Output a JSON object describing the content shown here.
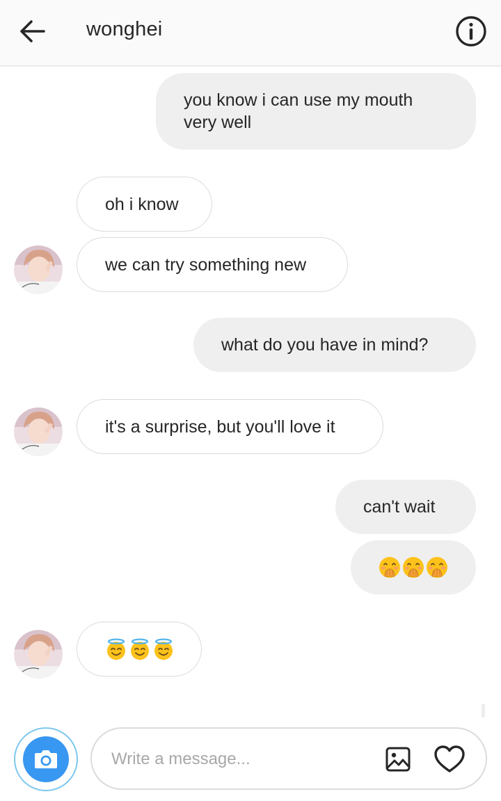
{
  "header": {
    "title": "wonghei",
    "back_icon": "arrow-left-icon",
    "info_icon": "info-circle-icon"
  },
  "messages": [
    {
      "direction": "sent",
      "lines": [
        "you know i can use my mouth",
        "very well"
      ]
    },
    {
      "direction": "received",
      "text": "oh i know"
    },
    {
      "direction": "received",
      "text": "we can try something new"
    },
    {
      "direction": "sent",
      "text": "what do you have in mind?"
    },
    {
      "direction": "received",
      "text": "it's a surprise, but you'll love it"
    },
    {
      "direction": "sent",
      "text": "can't wait"
    },
    {
      "direction": "sent",
      "emoji": [
        "hand-over-mouth-emoji",
        "hand-over-mouth-emoji",
        "hand-over-mouth-emoji"
      ]
    },
    {
      "direction": "received",
      "emoji": [
        "halo-smile-emoji",
        "halo-smile-emoji",
        "halo-smile-emoji"
      ]
    }
  ],
  "composer": {
    "placeholder": "Write a message...",
    "camera_icon": "camera-icon",
    "gallery_icon": "image-gallery-icon",
    "like_icon": "heart-icon"
  },
  "colors": {
    "sent_bubble": "#efefef",
    "received_border": "#dbdbdb",
    "camera_blue": "#3897f0",
    "text": "#262626"
  }
}
